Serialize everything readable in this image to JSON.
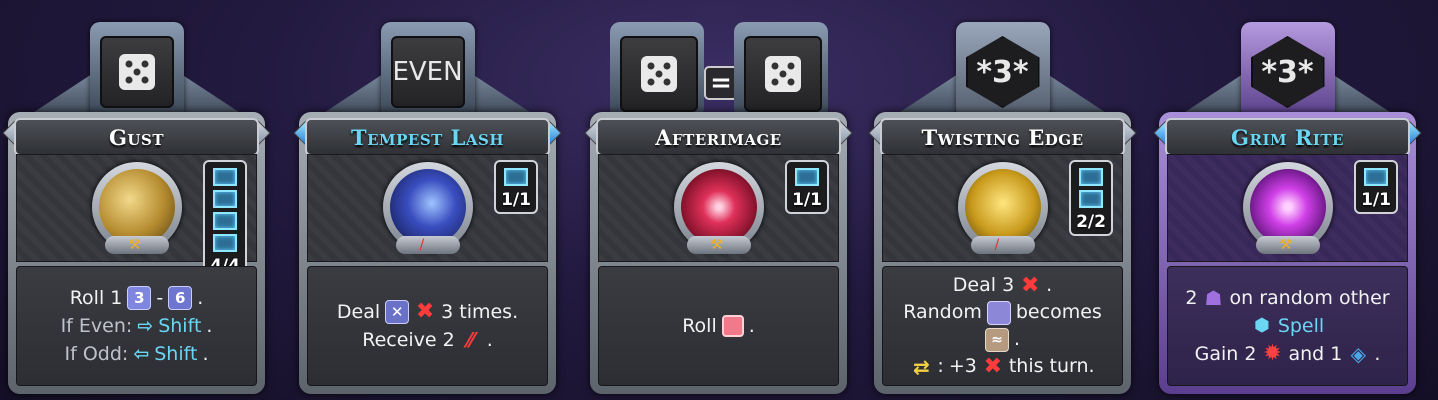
{
  "cards": [
    {
      "slot": "die",
      "title": "Gust",
      "charges": "4/4",
      "lines": [
        {
          "a": "Roll 1",
          "die_low": "3",
          "sep": "-",
          "die_high": "6",
          "end": "."
        },
        {
          "label": "If Even:",
          "arrow": "⇨",
          "kw": "Shift",
          "end": "."
        },
        {
          "label": "If Odd:",
          "arrow": "⇦",
          "kw": "Shift",
          "end": "."
        }
      ]
    },
    {
      "slot": "EVEN",
      "title": "Tempest Lash",
      "charges": "1/1",
      "lines": [
        {
          "a": "Deal",
          "b": "3 times."
        },
        {
          "a": "Receive 2",
          "end": "."
        }
      ]
    },
    {
      "slot": "die = die",
      "title": "Afterimage",
      "charges": "1/1",
      "lines": [
        {
          "a": "Roll",
          "end": "."
        }
      ]
    },
    {
      "slot": "*3*",
      "title": "Twisting Edge",
      "charges": "2/2",
      "lines": [
        {
          "a": "Deal 3",
          "end": "."
        },
        {
          "a": "Random",
          "b": "becomes"
        },
        {
          "end": "."
        },
        {
          "a": ":",
          "b": "+3",
          "c": "this turn."
        }
      ]
    },
    {
      "slot": "*3*",
      "title": "Grim Rite",
      "charges": "1/1",
      "lines": [
        {
          "a": "2",
          "b": "on random other"
        },
        {
          "kw": "Spell"
        },
        {
          "a": "Gain 2",
          "b": "and 1",
          "end": "."
        }
      ]
    }
  ],
  "icons": {
    "die": "die-icon",
    "damage": "sword-cross-icon",
    "bleed": "claw-icon",
    "gem": "gem-icon",
    "cube": "cube-icon",
    "wind": "wind-icon",
    "swap": "swap-icon",
    "hood": "hood-icon",
    "burst": "burst-icon",
    "shield": "shield-icon"
  },
  "colors": {
    "keyword": "#6ad6f4",
    "damage": "#ff3b3b",
    "charge": "#8fe6ff",
    "purple_frame": "#a990d8"
  }
}
